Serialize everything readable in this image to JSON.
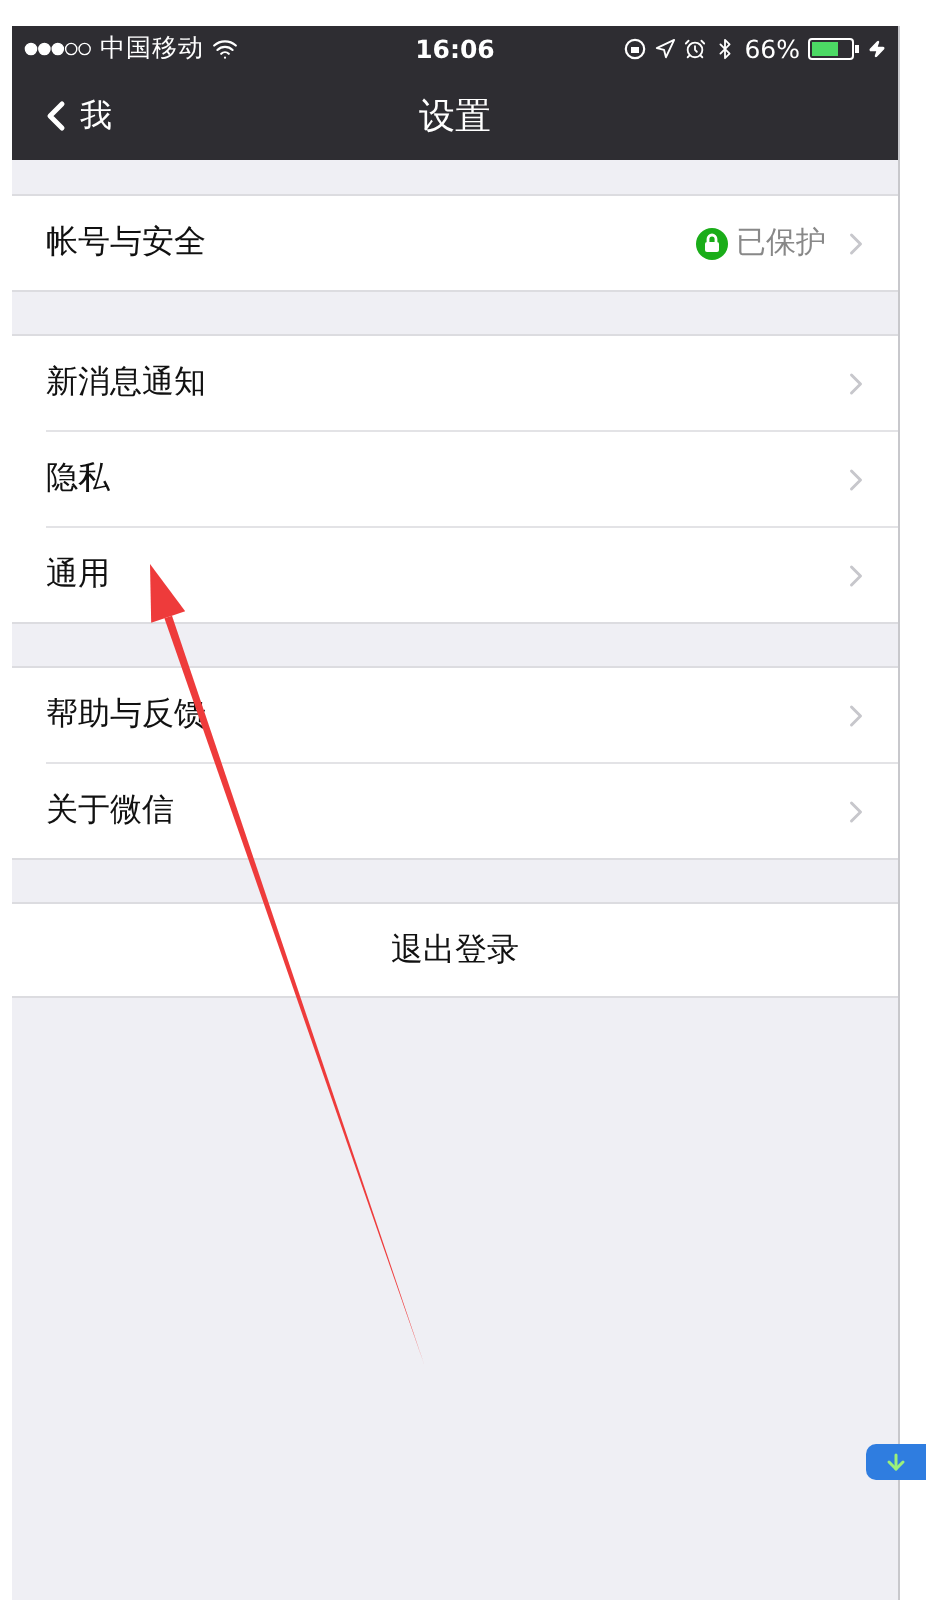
{
  "status_bar": {
    "carrier": "中国移动",
    "time": "16:06",
    "battery": "66%"
  },
  "nav_bar": {
    "back_label": "我",
    "title": "设置"
  },
  "sections": [
    {
      "rows": [
        {
          "label": "帐号与安全",
          "kind": "status",
          "value": "已保护"
        }
      ]
    },
    {
      "rows": [
        {
          "label": "新消息通知",
          "kind": "link"
        },
        {
          "label": "隐私",
          "kind": "link"
        },
        {
          "label": "通用",
          "kind": "link"
        }
      ]
    },
    {
      "rows": [
        {
          "label": "帮助与反馈",
          "kind": "link"
        },
        {
          "label": "关于微信",
          "kind": "link"
        }
      ]
    }
  ],
  "logout_button": "退出登录"
}
